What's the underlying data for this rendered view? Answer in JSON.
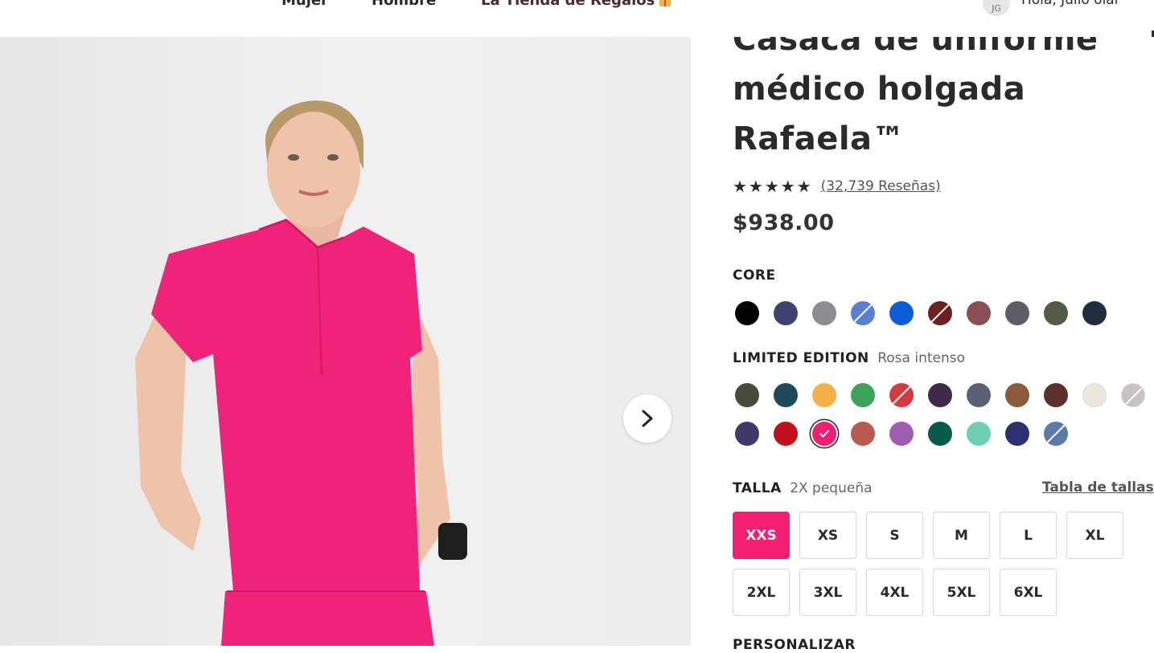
{
  "nav": {
    "women": "Mujer",
    "men": "Hombre",
    "gift_store": "La Tienda de Regalos",
    "avatar_initials": "JG",
    "greeting": "Hola, Julio olar"
  },
  "product": {
    "title": "Casaca de uniforme médico holgada Rafaela™",
    "stars": "★★★★★",
    "reviews_label": "(32,739 Reseñas)",
    "rating": 4.5,
    "price": "$938.00"
  },
  "colors": {
    "core_label": "CORE",
    "core": [
      {
        "name": "black-swatch",
        "color": "#000000"
      },
      {
        "name": "navy-swatch",
        "color": "#3f4173"
      },
      {
        "name": "gray-swatch",
        "color": "#8c8c93"
      },
      {
        "name": "blue-two-tone-swatch",
        "color": "#5a7fcf",
        "slash": true
      },
      {
        "name": "royal-blue-swatch",
        "color": "#0b5ed7"
      },
      {
        "name": "burgundy-two-tone-swatch",
        "color": "#6b2024",
        "slash": true
      },
      {
        "name": "mauve-swatch",
        "color": "#8b4f56"
      },
      {
        "name": "charcoal-swatch",
        "color": "#5f5b67"
      },
      {
        "name": "olive-swatch",
        "color": "#525a48"
      },
      {
        "name": "dark-navy-swatch",
        "color": "#1f2d3d"
      }
    ],
    "limited_label": "LIMITED EDITION",
    "selected_color_name": "Rosa intenso",
    "limited_row1": [
      {
        "name": "dark-olive-swatch",
        "color": "#4a4a3a"
      },
      {
        "name": "teal-swatch",
        "color": "#1d4a5a"
      },
      {
        "name": "mango-swatch",
        "color": "#f5b04a"
      },
      {
        "name": "green-swatch",
        "color": "#3ea35a"
      },
      {
        "name": "red-two-tone-swatch",
        "color": "#d63a40",
        "slash": true
      },
      {
        "name": "plum-swatch",
        "color": "#3f2a4a"
      },
      {
        "name": "slate-swatch",
        "color": "#5a6075"
      },
      {
        "name": "brown-swatch",
        "color": "#8a5a3a"
      },
      {
        "name": "espresso-swatch",
        "color": "#5a302e"
      },
      {
        "name": "cream-swatch",
        "color": "#ece8dc",
        "light": true
      },
      {
        "name": "light-gray-two-tone-swatch",
        "color": "#c7c3c3",
        "slash": true,
        "light": true
      }
    ],
    "limited_row2": [
      {
        "name": "indigo-swatch",
        "color": "#3f3a6a"
      },
      {
        "name": "crimson-swatch",
        "color": "#c1101c"
      },
      {
        "name": "hot-pink-swatch",
        "color": "#f21e72",
        "selected": true
      },
      {
        "name": "terracotta-swatch",
        "color": "#b85a52"
      },
      {
        "name": "orchid-swatch",
        "color": "#a05cb0"
      },
      {
        "name": "forest-teal-swatch",
        "color": "#0a5a4a"
      },
      {
        "name": "mint-swatch",
        "color": "#6fcfb3"
      },
      {
        "name": "royal-navy-swatch",
        "color": "#2d2f6e"
      },
      {
        "name": "steel-blue-two-tone-swatch",
        "color": "#5a7aa8",
        "slash": true
      }
    ]
  },
  "size": {
    "label": "TALLA",
    "selected_name": "2X pequeña",
    "guide_link": "Tabla de tallas",
    "options": [
      "XXS",
      "XS",
      "S",
      "M",
      "L",
      "XL",
      "2XL",
      "3XL",
      "4XL",
      "5XL",
      "6XL"
    ],
    "selected": "XXS"
  },
  "personalize_label": "PERSONALIZAR",
  "accent": "#f21e72"
}
